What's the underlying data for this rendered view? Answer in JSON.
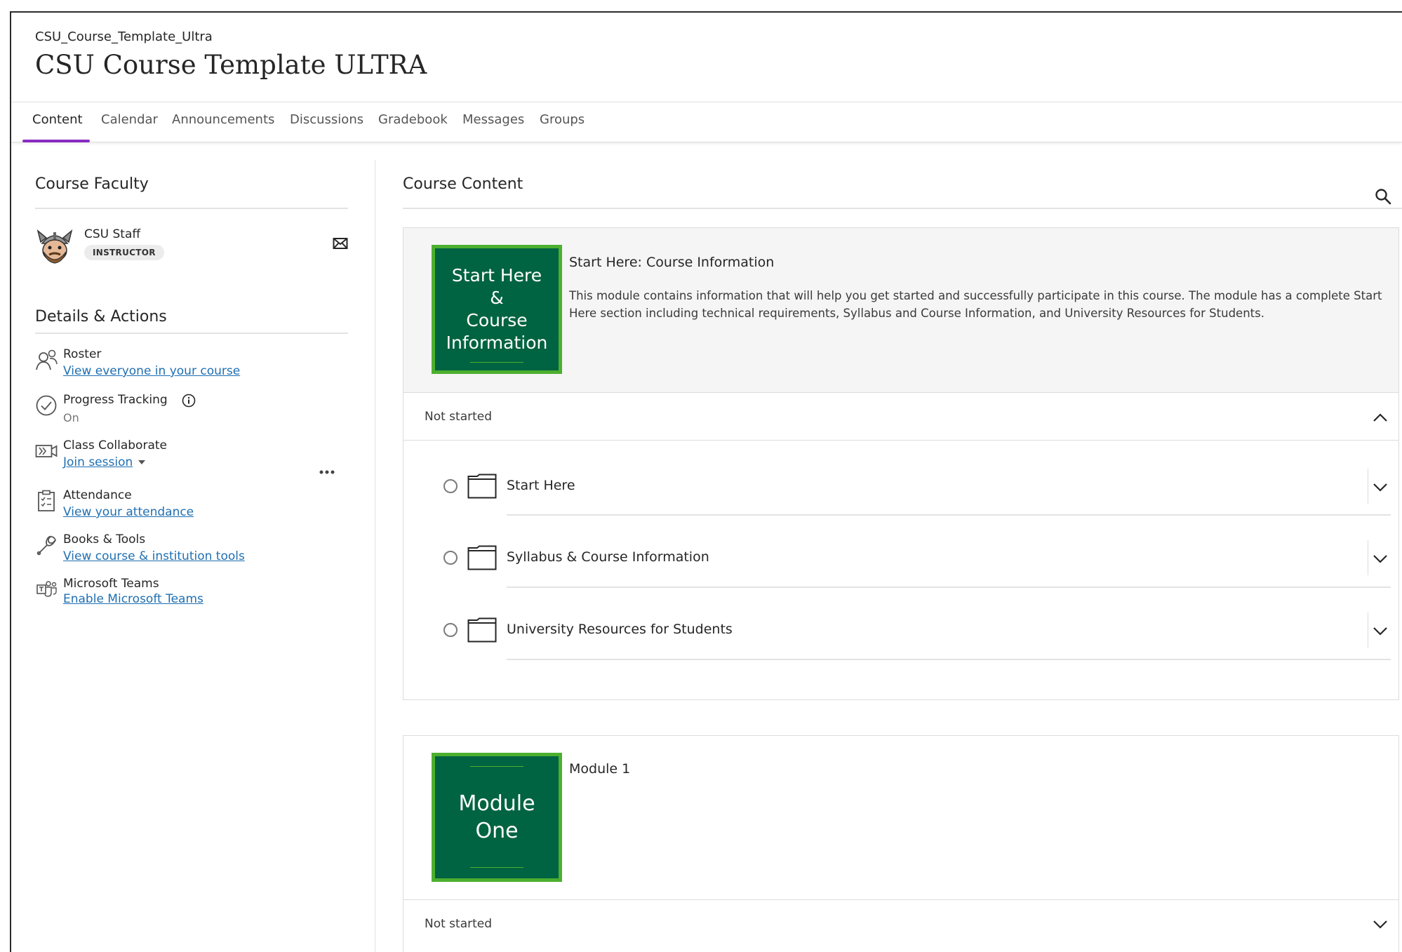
{
  "header": {
    "breadcrumb": "CSU_Course_Template_Ultra",
    "course_title": "CSU Course Template ULTRA"
  },
  "tabs": [
    {
      "label": "Content",
      "active": true
    },
    {
      "label": "Calendar"
    },
    {
      "label": "Announcements"
    },
    {
      "label": "Discussions"
    },
    {
      "label": "Gradebook"
    },
    {
      "label": "Messages"
    },
    {
      "label": "Groups"
    }
  ],
  "accent_color": "#8a2cc1",
  "link_color": "#1f6fb2",
  "faculty": {
    "section_title": "Course Faculty",
    "name": "CSU Staff",
    "role": "INSTRUCTOR"
  },
  "details": {
    "section_title": "Details & Actions",
    "roster": {
      "label": "Roster",
      "link": "View everyone in your course"
    },
    "progress": {
      "label": "Progress Tracking",
      "status": "On"
    },
    "collaborate": {
      "label": "Class Collaborate",
      "link": "Join session"
    },
    "attendance": {
      "label": "Attendance",
      "link": "View your attendance"
    },
    "books": {
      "label": "Books & Tools",
      "link": "View course & institution tools"
    },
    "teams": {
      "label": "Microsoft Teams",
      "link": "Enable Microsoft Teams"
    }
  },
  "content": {
    "section_title": "Course Content",
    "modules": [
      {
        "thumb_lines": [
          "Start Here",
          "&",
          "Course",
          "Information"
        ],
        "title": "Start Here: Course Information",
        "description": "This module contains information that will help you get started and successfully participate in this course. The module has a complete Start Here section including technical requirements, Syllabus and Course Information, and University Resources for Students.",
        "status": "Not started",
        "expanded": true,
        "items": [
          {
            "label": "Start Here"
          },
          {
            "label": "Syllabus & Course Information"
          },
          {
            "label": "University Resources for Students"
          }
        ]
      },
      {
        "thumb_lines": [
          "Module",
          "One"
        ],
        "title": "Module 1",
        "status": "Not started",
        "expanded": false
      }
    ]
  },
  "brand": {
    "thumb_green": "#006341",
    "thumb_border": "#4caf2f"
  }
}
